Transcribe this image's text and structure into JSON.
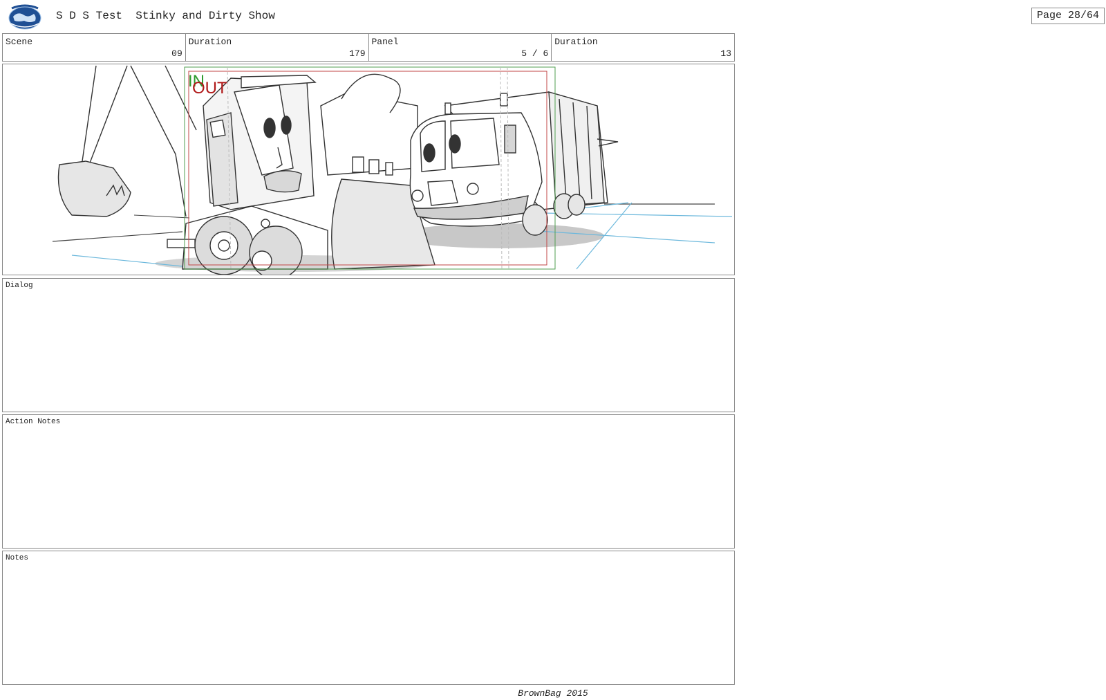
{
  "header": {
    "logo_name": "nightflight-globe-logo",
    "title": "S D S Test  Stinky and Dirty Show",
    "page": "Page 28/64"
  },
  "info": {
    "scene_label": "Scene",
    "scene_value": "09",
    "duration_label": "Duration",
    "duration_value": "179",
    "panel_label": "Panel",
    "panel_value": "5 / 6",
    "panel_duration_label": "Duration",
    "panel_duration_value": "13"
  },
  "storyboard": {
    "in_label": "IN",
    "out_label": "OUT",
    "in_color": "#2e9b2e",
    "out_color": "#b01818",
    "perspective_color": "#6cb8dc"
  },
  "sections": {
    "dialog_label": "Dialog",
    "action_label": "Action Notes",
    "notes_label": "Notes"
  },
  "footer": {
    "text": "BrownBag 2015"
  }
}
